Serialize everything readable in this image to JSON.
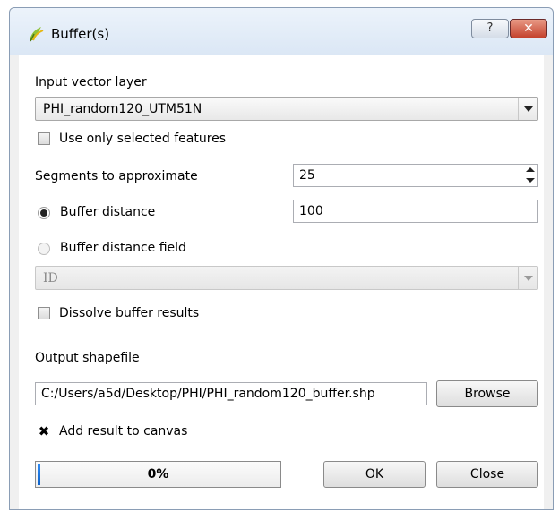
{
  "window": {
    "title": "Buffer(s)",
    "help_label": "?",
    "close_label": "✕"
  },
  "input_layer": {
    "label": "Input vector layer",
    "selected": "PHI_random120_UTM51N"
  },
  "use_selected": {
    "label": "Use only selected features",
    "checked": false
  },
  "segments": {
    "label": "Segments to approximate",
    "value": "25"
  },
  "buffer_distance": {
    "label": "Buffer distance",
    "value": "100",
    "selected": true
  },
  "buffer_field": {
    "label": "Buffer distance field",
    "selected_field": "ID",
    "enabled": false
  },
  "dissolve": {
    "label": "Dissolve buffer results",
    "checked": false
  },
  "output": {
    "label": "Output shapefile",
    "path": "C:/Users/a5d/Desktop/PHI/PHI_random120_buffer.shp",
    "browse_label": "Browse"
  },
  "add_to_canvas": {
    "label": "Add result to canvas",
    "checked": true,
    "check_glyph": "✖"
  },
  "progress": {
    "text": "0%",
    "percent": 0
  },
  "buttons": {
    "ok": "OK",
    "close": "Close"
  },
  "icons": {
    "app": "qgis-icon"
  }
}
